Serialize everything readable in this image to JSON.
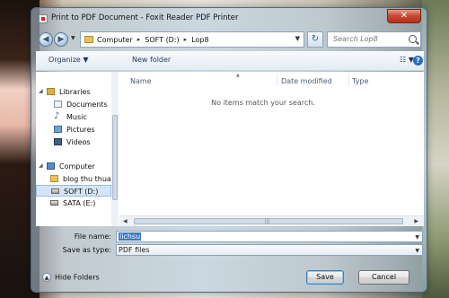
{
  "window": {
    "title": "Print to PDF Document - Foxit Reader PDF Printer",
    "close": "✕"
  },
  "nav": {
    "back": "◀",
    "forward": "▶",
    "history": "▼",
    "breadcrumb": [
      "Computer",
      "SOFT (D:)",
      "Lop8"
    ],
    "separator": "▸",
    "dropdown": "▼",
    "refresh": "↻",
    "search_placeholder": "Search Lop8"
  },
  "toolbar": {
    "organize": "Organize ▼",
    "new_folder": "New folder",
    "views": "☷ ▼",
    "help": "?"
  },
  "sidebar": {
    "items": [
      {
        "label": "Libraries",
        "icon": "library-icon"
      },
      {
        "label": "Documents",
        "icon": "documents-icon"
      },
      {
        "label": "Music",
        "icon": "music-icon",
        "glyph": "♪"
      },
      {
        "label": "Pictures",
        "icon": "pictures-icon"
      },
      {
        "label": "Videos",
        "icon": "videos-icon"
      },
      {
        "label": "Computer",
        "icon": "computer-icon"
      },
      {
        "label": "blog thu thuat",
        "icon": "folder-icon"
      },
      {
        "label": "SOFT (D:)",
        "icon": "drive-icon"
      },
      {
        "label": "SATA (E:)",
        "icon": "drive-icon"
      }
    ]
  },
  "filelist": {
    "columns": [
      "Name",
      "Date modified",
      "Type"
    ],
    "empty_message": "No items match your search.",
    "scroll_left": "◀",
    "scroll_right": "▶",
    "grip": "|||"
  },
  "form": {
    "file_name_label": "File name:",
    "file_name_value": "lichsu",
    "save_as_type_label": "Save as type:",
    "save_as_type_value": "PDF files",
    "dropdown": "▼"
  },
  "footer": {
    "hide_folders": "Hide Folders",
    "hide_icon": "▲",
    "save": "Save",
    "cancel": "Cancel"
  },
  "colors": {
    "accent": "#3a78c9",
    "close_button": "#c8452e",
    "selection": "#d5e5f7"
  }
}
